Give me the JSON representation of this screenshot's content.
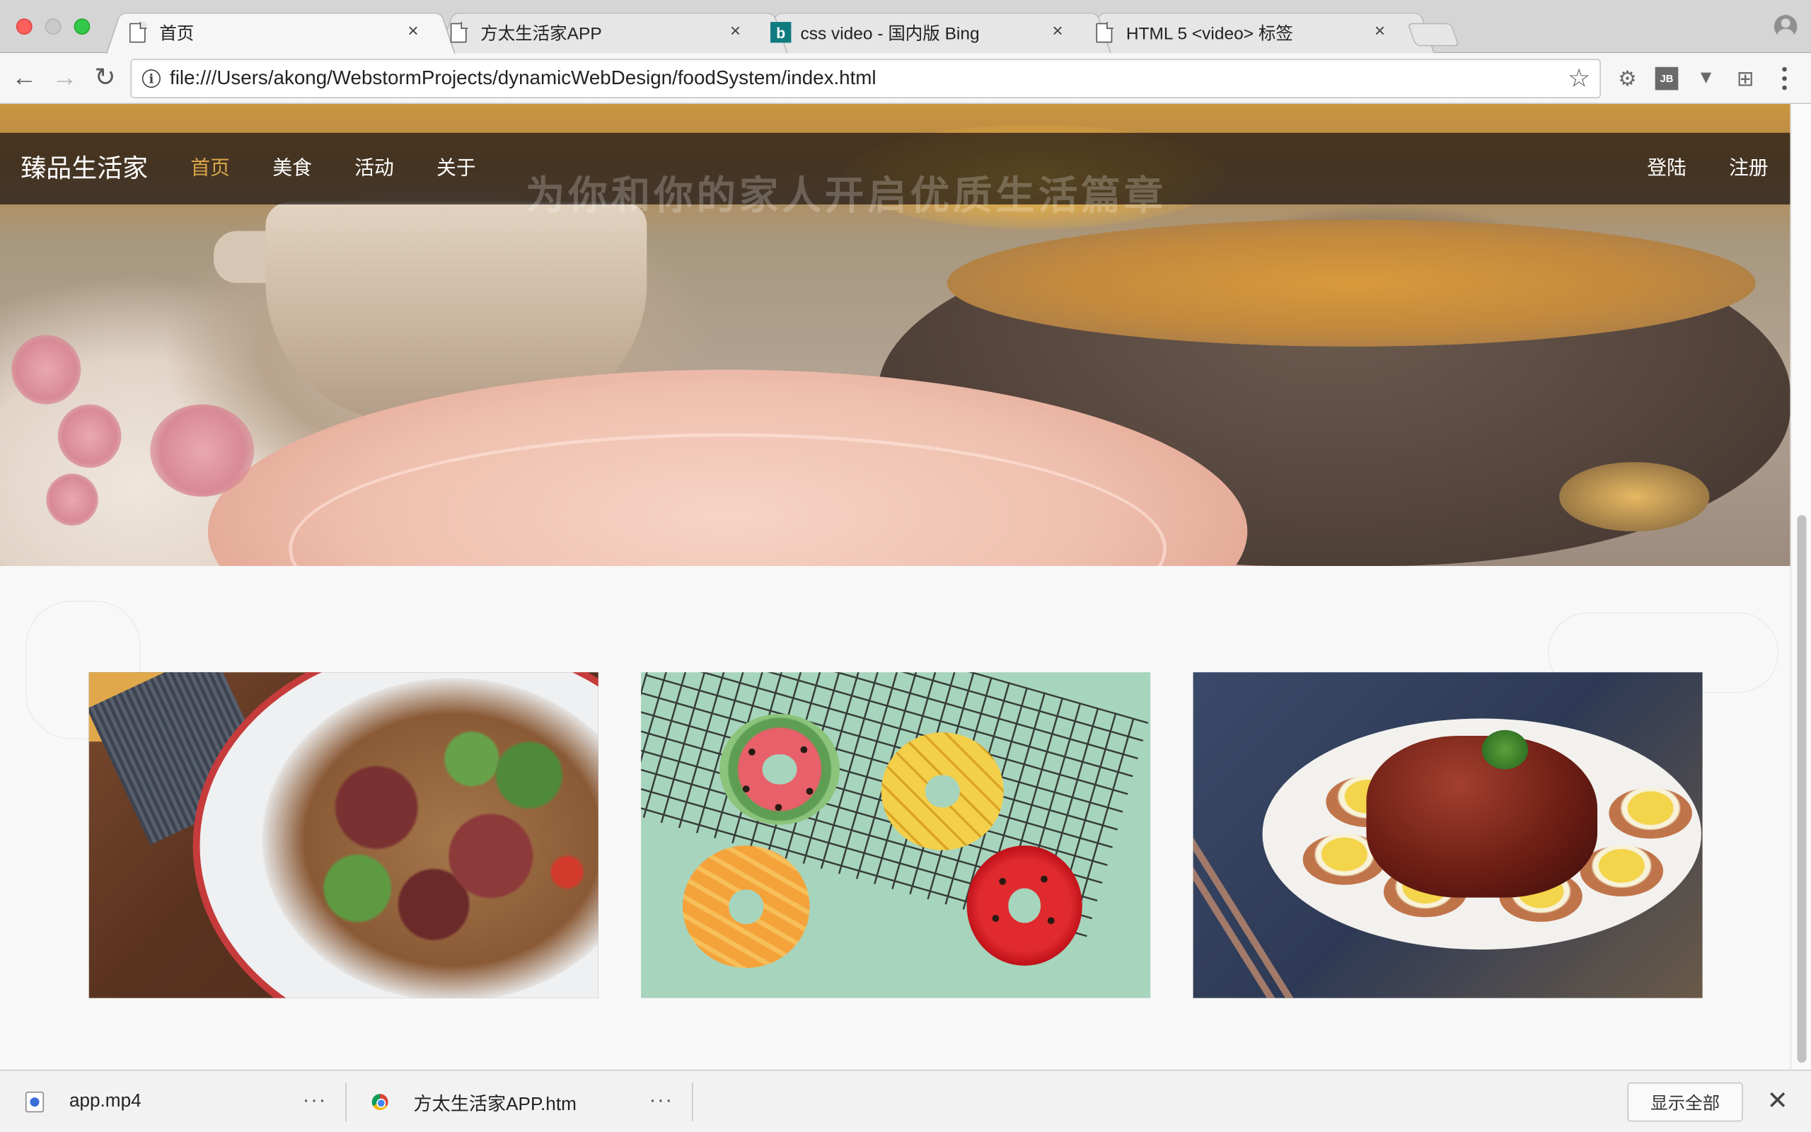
{
  "browser": {
    "tabs": [
      {
        "title": "首页",
        "icon": "file-icon",
        "active": true
      },
      {
        "title": "方太生活家APP",
        "icon": "file-icon",
        "active": false
      },
      {
        "title": "css video - 国内版 Bing",
        "icon": "bing-icon",
        "active": false
      },
      {
        "title": "HTML 5 <video> 标签",
        "icon": "file-icon",
        "active": false
      }
    ],
    "tab_close": "×",
    "address": "file:///Users/akong/WebstormProjects/dynamicWebDesign/foodSystem/index.html",
    "bing_letter": "b",
    "jb_label": "JB"
  },
  "site": {
    "brand": "臻品生活家",
    "nav": [
      {
        "label": "首页",
        "current": true
      },
      {
        "label": "美食",
        "current": false
      },
      {
        "label": "活动",
        "current": false
      },
      {
        "label": "关于",
        "current": false
      }
    ],
    "login": "登陆",
    "register": "注册",
    "slogan": "为你和你的家人开启优质生活篇章",
    "accent_color": "#d9a54a",
    "cards": [
      {
        "name": "salad-image",
        "icon": "salad-photo"
      },
      {
        "name": "donuts-image",
        "icon": "donut-photo"
      },
      {
        "name": "braised-pork-image",
        "icon": "pork-photo"
      }
    ]
  },
  "downloads": {
    "items": [
      {
        "name": "app.mp4",
        "icon": "video-file-icon"
      },
      {
        "name": "方太生活家APP.htm",
        "icon": "chrome-file-icon"
      }
    ],
    "more": "···",
    "show_all": "显示全部",
    "close": "✕"
  }
}
